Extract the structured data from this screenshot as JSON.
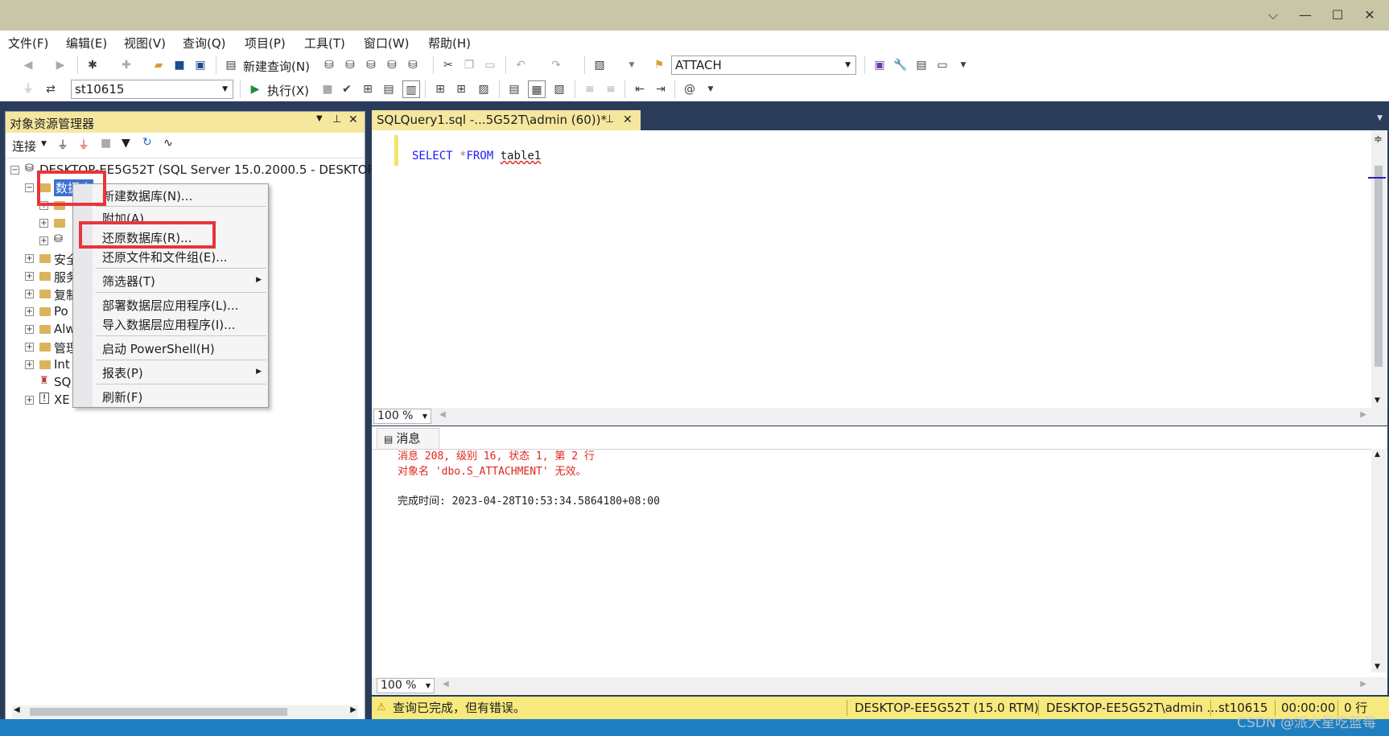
{
  "titlebar": {
    "minimize": "—",
    "maximize": "☐",
    "close": "✕",
    "chevron": "⌵"
  },
  "menu": [
    "文件(F)",
    "编辑(E)",
    "视图(V)",
    "查询(Q)",
    "项目(P)",
    "工具(T)",
    "窗口(W)",
    "帮助(H)"
  ],
  "toolbar1": {
    "new_query": "新建查询(N)",
    "combo_value": "ATTACH"
  },
  "toolbar2": {
    "db_combo": "st10615",
    "execute": "执行(X)"
  },
  "object_explorer": {
    "title": "对象资源管理器",
    "connect": "连接",
    "server_node": "DESKTOP-EE5G52T (SQL Server 15.0.2000.5 - DESKTOP-",
    "databases_node": "数据库",
    "children": [
      "安全",
      "服务",
      "复制",
      "Po",
      "Alw",
      "管理",
      "Int",
      "SQ",
      "XE"
    ]
  },
  "context_menu": {
    "items": [
      "新建数据库(N)...",
      "附加(A)...",
      "还原数据库(R)...",
      "还原文件和文件组(E)...",
      "筛选器(T)",
      "部署数据层应用程序(L)...",
      "导入数据层应用程序(I)...",
      "启动 PowerShell(H)",
      "报表(P)",
      "刷新(F)"
    ]
  },
  "editor": {
    "tab_title": "SQLQuery1.sql -...5G52T\\admin (60))*",
    "code": {
      "kw1": "SELECT",
      "star": "*",
      "kw2": "FROM",
      "table": "table1"
    },
    "zoom": "100 %"
  },
  "results": {
    "tab_label": "消息",
    "line1": "消息 208, 级别 16, 状态 1, 第 2 行",
    "line2": "对象名 'dbo.S_ATTACHMENT' 无效。",
    "line3": "完成时间: 2023-04-28T10:53:34.5864180+08:00",
    "zoom": "100 %"
  },
  "statusbar": {
    "message": "查询已完成，但有错误。",
    "server": "DESKTOP-EE5G52T (15.0 RTM)",
    "user": "DESKTOP-EE5G52T\\admin ...",
    "database": "st10615",
    "elapsed": "00:00:00",
    "rows": "0 行"
  },
  "watermark": "CSDN @派大星吃蓝莓",
  "colors": {
    "highlight": "#e8353a",
    "error_text": "#e0261e",
    "keyword": "#1a1aff",
    "panel_header": "#f5e89e",
    "status_bar": "#f7e97e"
  }
}
